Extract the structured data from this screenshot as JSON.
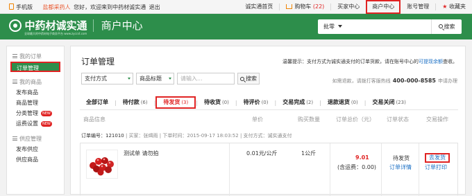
{
  "topbar": {
    "mobile": "手机版",
    "welcome": "盐都采药人",
    "hello": "您好，欢迎来到中药材诚实通",
    "logout": "退出",
    "home": "诚实通首页",
    "cart": "购物车",
    "cart_count": "(22)",
    "buyer": "买家中心",
    "merchant": "商户中心",
    "account": "账号管理",
    "favorites": "收藏夹"
  },
  "header": {
    "brand": "中药材诚实通",
    "subtitle": "全球最大的中药材电子商务平台 www.zyccst.com",
    "section": "商户中心",
    "search_type": "批零",
    "search_button": "搜索"
  },
  "sidebar": {
    "groups": [
      {
        "title": "我的订单",
        "items": [
          {
            "label": "订单管理"
          }
        ]
      },
      {
        "title": "我的商品",
        "items": [
          {
            "label": "发布商品"
          },
          {
            "label": "商品管理"
          },
          {
            "label": "分类管理",
            "badge": "NEW"
          },
          {
            "label": "运费设置",
            "badge": "NEW"
          }
        ]
      },
      {
        "title": "供应管理",
        "items": [
          {
            "label": "发布供应"
          },
          {
            "label": "供应商品"
          }
        ]
      }
    ]
  },
  "main": {
    "title": "订单管理",
    "tip_prefix": "温馨提示：支付方式为诚实通支付的订单货款，请在账号中心的",
    "tip_link": "可提现余额",
    "tip_suffix": "查收。",
    "filter_pay": "支付方式",
    "filter_goods": "商品标题",
    "filter_placeholder": "请输入...",
    "filter_button": "搜索",
    "hotline_prefix": "如需退款，请拨打客服热线",
    "hotline_number": "400-000-8585",
    "hotline_suffix": "申请办理",
    "tabs": [
      {
        "label": "全部订单",
        "count": ""
      },
      {
        "label": "待付款",
        "count": "(6)"
      },
      {
        "label": "待发货",
        "count": "(3)"
      },
      {
        "label": "待收货",
        "count": "(0)"
      },
      {
        "label": "待评价",
        "count": "(0)"
      },
      {
        "label": "交易完成",
        "count": "(2)"
      },
      {
        "label": "退款退货",
        "count": "(0)"
      },
      {
        "label": "交易关闭",
        "count": "(23)"
      }
    ],
    "columns": {
      "info": "商品信息",
      "price": "单价",
      "qty": "购买数量",
      "total": "订单总价（元）",
      "status": "订单状态",
      "action": "交易操作"
    },
    "order": {
      "number_label": "订单编号：",
      "number": "121010",
      "buyer": "买家：张缉雨",
      "time": "下单时间：2015-09-17 18:03:52",
      "pay": "支付方式：诚实通支付",
      "product": "测试单 请勿拍",
      "unit_price": "0.01元/公斤",
      "qty": "1公斤",
      "total": "9.01",
      "freight": "(含运费：0.00)",
      "status": "待发货",
      "detail": "订单详情",
      "ship": "去发货",
      "print": "订单打印"
    }
  }
}
